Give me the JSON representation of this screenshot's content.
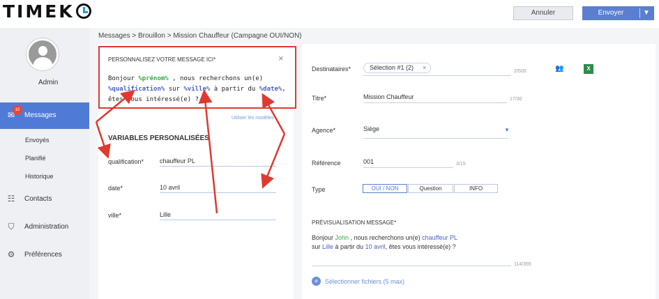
{
  "app": {
    "logo": "TIMEK",
    "cancel_label": "Annuler",
    "send_label": "Envoyer",
    "send_caret": "▼"
  },
  "sidebar": {
    "user": "Admin",
    "messages": {
      "label": "Messages",
      "badge": "10",
      "icon": "envelope-icon"
    },
    "sub_items": [
      "Envoyés",
      "Planifié",
      "Historique"
    ],
    "items": [
      {
        "label": "Contacts",
        "icon": "contacts-icon"
      },
      {
        "label": "Administration",
        "icon": "shield-icon"
      },
      {
        "label": "Préférences",
        "icon": "gear-icon"
      }
    ]
  },
  "breadcrumb": {
    "root": "Messages",
    "sep": ">",
    "draft": "Brouillon",
    "current": "Mission Chauffeur (Campagne OUI/NON)"
  },
  "message_box": {
    "title": "PERSONNALISEZ VOTRE MESSAGE ICI*",
    "close": "×",
    "text_1": "Bonjour ",
    "var_prenom": "%prénom%",
    "text_2": " , nous recherchons un(e)",
    "var_qualification": "%qualification%",
    "text_3": " sur ",
    "var_ville": "%ville%",
    "text_4": " à partir du ",
    "var_date": "%date%",
    "text_5": ",",
    "text_6": "êtes vous intéressé(e) ?",
    "use_models": "Utiliser les modèles"
  },
  "variables": {
    "title": "VARIABLES PERSONALISÉES",
    "fields": [
      {
        "label": "qualification*",
        "value": "chauffeur PL"
      },
      {
        "label": "date*",
        "value": "10 avril"
      },
      {
        "label": "ville*",
        "value": "Lille"
      }
    ]
  },
  "form": {
    "recipients_label": "Destinataires*",
    "recipients_chip": "Sélection #1 (2)",
    "recipients_chip_remove": "×",
    "recipients_counter": "2/500",
    "title_label": "Titre*",
    "title_value": "Mission Chauffeur",
    "title_counter": "17/30",
    "agency_label": "Agence*",
    "agency_value": "Siège",
    "agency_caret": "▼",
    "reference_label": "Référence",
    "reference_value": "001",
    "reference_counter": "3/15",
    "type_label": "Type",
    "type_options": [
      "OUI / NON",
      "Question",
      "INFO"
    ],
    "type_selected": "OUI / NON"
  },
  "preview": {
    "title": "PRÉVISUALISATION MESSAGE*",
    "t1": "Bonjour ",
    "name": "John",
    "t2": " , nous recherchons un(e) ",
    "qualification": "chauffeur PL",
    "t3": "sur ",
    "city": "Lille",
    "t4": " à partir du ",
    "date": "10 avril",
    "t5": ", êtes vous intéressé(e) ?",
    "counter": "114/355",
    "files_label": "Sélectionner fichiers (5 max)"
  },
  "colors": {
    "accent": "#4f7bd6",
    "annotation_red": "#e0392f",
    "variable_green": "#3aa84a",
    "variable_blue": "#4a5fc1"
  }
}
